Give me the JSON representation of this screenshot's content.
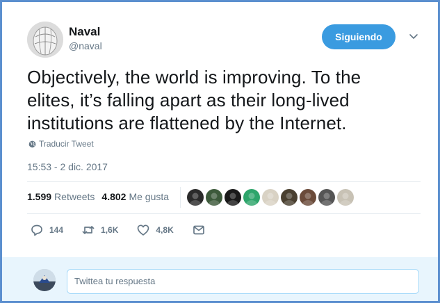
{
  "author": {
    "name": "Naval",
    "handle": "@naval"
  },
  "follow_button": {
    "label": "Siguiendo"
  },
  "tweet": {
    "text_line1": "Objectively, the world is improving. To the",
    "text_line2": "elites, it’s falling apart as their long-lived",
    "text_line3": "institutions are flattened by the Internet.",
    "translate_label": "Traducir Tweet",
    "timestamp": "15:53 - 2 dic. 2017"
  },
  "stats": {
    "retweets_count": "1.599",
    "retweets_label": "Retweets",
    "likes_count": "4.802",
    "likes_label": "Me gusta"
  },
  "likers": [
    {
      "color": "#2b2b2b"
    },
    {
      "color": "#3d5a3b"
    },
    {
      "color": "#1a1a1a"
    },
    {
      "color": "#2ea56b"
    },
    {
      "color": "#d9d2c4"
    },
    {
      "color": "#4a4030"
    },
    {
      "color": "#6b4b3a"
    },
    {
      "color": "#555555"
    },
    {
      "color": "#c8c2b5"
    }
  ],
  "actions": {
    "replies": "144",
    "retweets": "1,6K",
    "likes": "4,8K"
  },
  "reply": {
    "placeholder": "Twittea tu respuesta"
  },
  "colors": {
    "accent": "#1da1f2",
    "frame_border": "#5b8fcf",
    "muted_text": "#657786"
  }
}
